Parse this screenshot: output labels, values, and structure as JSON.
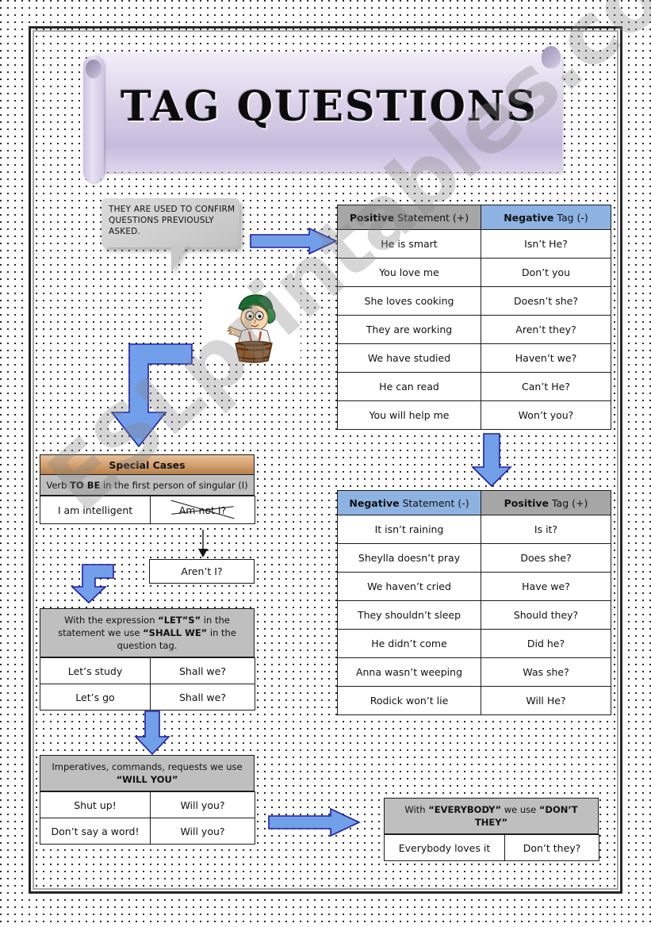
{
  "title": "TAG QUESTIONS",
  "intro_bubble": {
    "text": "THEY ARE USED TO CONFIRM QUESTIONS PREVIOUSLY ASKED."
  },
  "clipart": {
    "name": "boy-in-barrel-pointing-clipart"
  },
  "watermark": {
    "text": "ESLprintables.com"
  },
  "tables": {
    "positive": {
      "headers": [
        {
          "strong": "Positive",
          "rest": " Statement (+)",
          "bg": "#a6a6a6"
        },
        {
          "strong": "Negative",
          "rest": " Tag (-)",
          "bg": "#8db3e2"
        }
      ],
      "rows": [
        [
          "He is smart",
          "Isn’t He?"
        ],
        [
          "You love me",
          "Don’t you"
        ],
        [
          "She loves cooking",
          "Doesn’t she?"
        ],
        [
          "They are working",
          "Aren’t they?"
        ],
        [
          "We have studied",
          "Haven’t we?"
        ],
        [
          "He can read",
          "Can’t He?"
        ],
        [
          "You will help me",
          "Won’t you?"
        ]
      ]
    },
    "negative": {
      "headers": [
        {
          "strong": "Negative",
          "rest": " Statement (-)",
          "bg": "#8db3e2"
        },
        {
          "strong": "Positive",
          "rest": " Tag (+)",
          "bg": "#a6a6a6"
        }
      ],
      "rows": [
        [
          "It isn’t raining",
          "Is it?"
        ],
        [
          "Sheylla doesn’t pray",
          "Does she?"
        ],
        [
          "We haven’t cried",
          "Have we?"
        ],
        [
          "They shouldn’t sleep",
          "Should they?"
        ],
        [
          "He didn’t come",
          "Did he?"
        ],
        [
          "Anna wasn’t weeping",
          "Was she?"
        ],
        [
          "Rodick won’t lie",
          "Will He?"
        ]
      ]
    }
  },
  "special_cases": {
    "header": "Special Cases",
    "subheader_pre": "Verb ",
    "subheader_strong": "TO BE",
    "subheader_post": " in the first person of singular (I)",
    "row": [
      "I am intelligent",
      "Am not I?"
    ],
    "corrected": "Aren’t I?"
  },
  "lets_block": {
    "note_pre": "With the expression ",
    "note_strong1": "“LET”S”",
    "note_mid": " in the statement we use ",
    "note_strong2": "“SHALL WE”",
    "note_post": " in the question tag.",
    "rows": [
      [
        "Let’s study",
        "Shall we?"
      ],
      [
        "Let’s go",
        "Shall we?"
      ]
    ]
  },
  "imperatives_block": {
    "note_pre": "Imperatives, commands, requests we use ",
    "note_strong": "“WILL YOU”",
    "rows": [
      [
        "Shut up!",
        "Will you?"
      ],
      [
        "Don’t say a word!",
        "Will you?"
      ]
    ]
  },
  "everybody_block": {
    "note_pre": "With ",
    "note_strong1": "“EVERYBODY”",
    "note_mid": " we use ",
    "note_strong2": "“DON’T THEY”",
    "rows": [
      [
        "Everybody loves it",
        "Don’t they?"
      ]
    ]
  },
  "colors": {
    "header_gray": "#a6a6a6",
    "header_blue": "#8db3e2",
    "note_gray": "#bfbfbf",
    "special_orange": "#d7a574",
    "arrow_fill": "#729fea",
    "arrow_stroke": "#1f1fa0"
  }
}
